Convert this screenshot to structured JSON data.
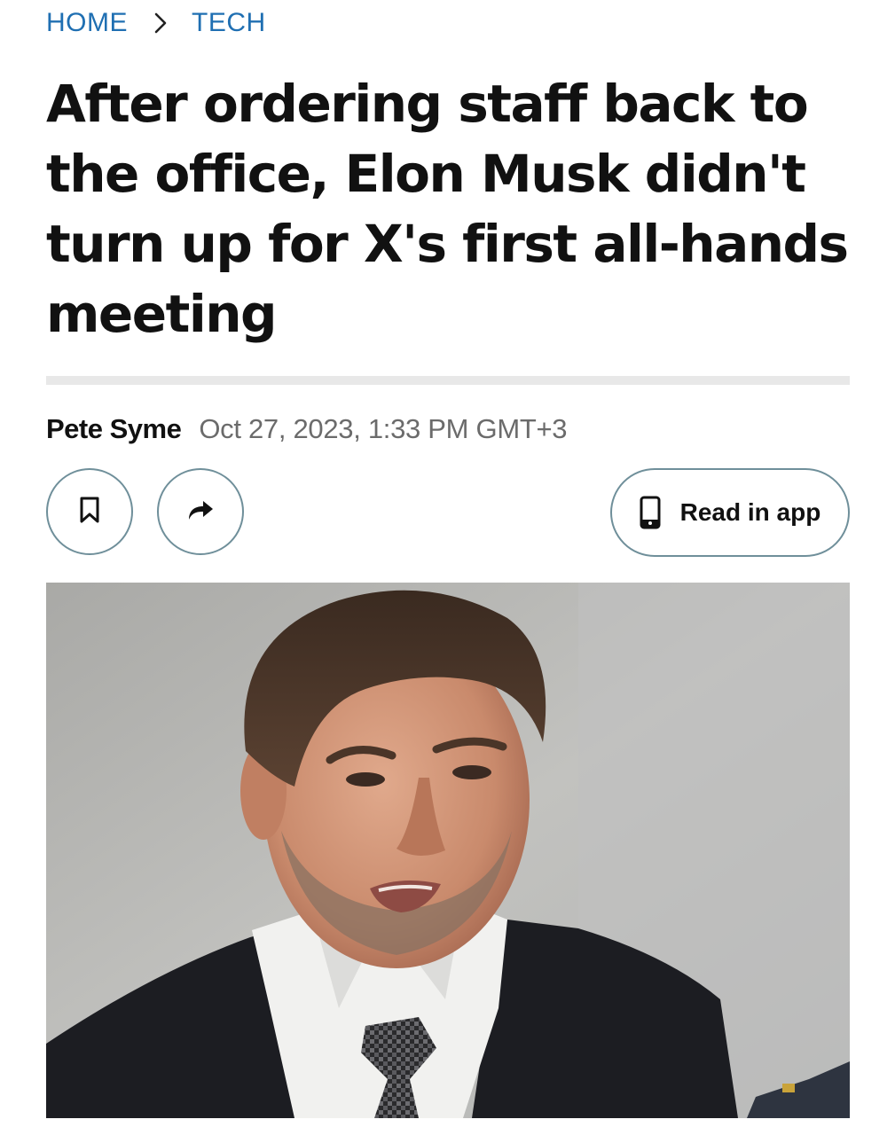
{
  "breadcrumb": {
    "home": "HOME",
    "section": "TECH"
  },
  "article": {
    "title": "After ordering staff back to the office, Elon Musk didn't turn up for X's first all-hands meeting",
    "author": "Pete Syme",
    "date": "Oct 27, 2023, 1:33 PM GMT+3"
  },
  "actions": {
    "save_icon": "bookmark-icon",
    "share_icon": "share-arrow-icon",
    "read_in_app_icon": "phone-icon",
    "read_in_app_label": "Read in app"
  },
  "colors": {
    "breadcrumb_link": "#1f6fb2",
    "button_border": "#6f8f9a",
    "divider": "#e8e8e8",
    "date_text": "#6b6b6b"
  }
}
